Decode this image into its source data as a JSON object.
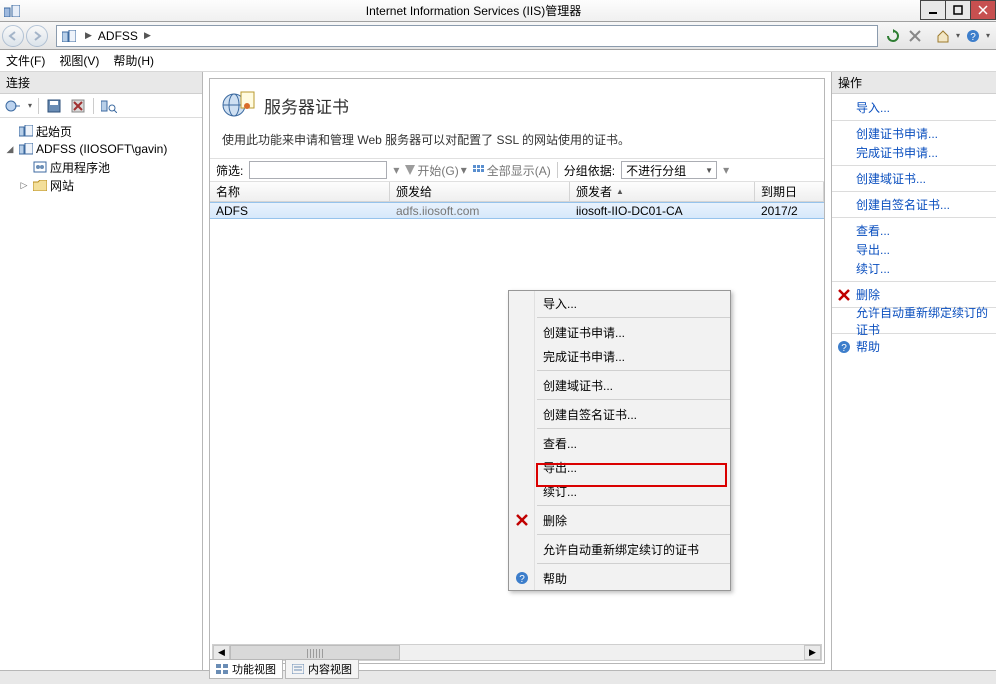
{
  "window": {
    "title": "Internet Information Services (IIS)管理器"
  },
  "breadcrumb": {
    "node": "ADFSS"
  },
  "nav_icons": {
    "refresh": "refresh",
    "stop": "stop",
    "home": "home",
    "help": "help"
  },
  "menu": {
    "file": "文件(F)",
    "view": "视图(V)",
    "help": "帮助(H)"
  },
  "conn": {
    "header": "连接",
    "start": "起始页",
    "server": "ADFSS (IIOSOFT\\gavin)",
    "apppool": "应用程序池",
    "sites": "网站"
  },
  "page": {
    "title": "服务器证书",
    "desc": "使用此功能来申请和管理 Web 服务器可以对配置了 SSL 的网站使用的证书。"
  },
  "filter": {
    "label": "筛选:",
    "start": "开始(G)",
    "showall": "全部显示(A)",
    "groupby": "分组依据:",
    "group_value": "不进行分组"
  },
  "cols": {
    "name": "名称",
    "issued_to": "颁发给",
    "issued_by": "颁发者",
    "expire": "到期日"
  },
  "rows": [
    {
      "name": "ADFS",
      "issued_to": "adfs.iiosoft.com",
      "issued_by": "iiosoft-IIO-DC01-CA",
      "expire": "2017/2"
    }
  ],
  "actions": {
    "header": "操作",
    "import": "导入...",
    "create_req": "创建证书申请...",
    "complete_req": "完成证书申请...",
    "create_domain": "创建域证书...",
    "create_self": "创建自签名证书...",
    "view": "查看...",
    "export": "导出...",
    "renew": "续订...",
    "delete": "删除",
    "autorebind": "允许自动重新绑定续订的证书",
    "help": "帮助"
  },
  "ctx": {
    "import": "导入...",
    "create_req": "创建证书申请...",
    "complete_req": "完成证书申请...",
    "create_domain": "创建域证书...",
    "create_self": "创建自签名证书...",
    "view": "查看...",
    "export": "导出...",
    "renew": "续订...",
    "delete": "删除",
    "autorebind": "允许自动重新绑定续订的证书",
    "help": "帮助"
  },
  "tabs": {
    "features": "功能视图",
    "content": "内容视图"
  }
}
